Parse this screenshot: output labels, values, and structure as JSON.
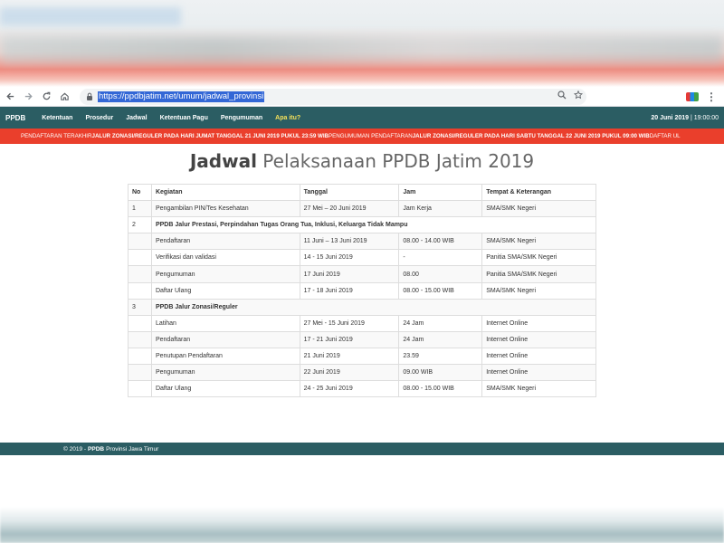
{
  "browser": {
    "url": "https://ppdbjatim.net/umum/jadwal_provinsi",
    "back_icon": "arrow-left-icon",
    "forward_icon": "arrow-right-icon",
    "reload_icon": "reload-icon",
    "home_icon": "home-icon"
  },
  "navbar": {
    "brand": "PPDB",
    "items": [
      {
        "label": "Ketentuan"
      },
      {
        "label": "Prosedur"
      },
      {
        "label": "Jadwal"
      },
      {
        "label": "Ketentuan Pagu"
      },
      {
        "label": "Pengumuman"
      },
      {
        "label": "Apa itu?"
      }
    ],
    "date": "20 Juni 2019",
    "separator": "|",
    "time": "19:00:00",
    "bg_color": "#2b5d63",
    "highlight_color": "#f5e15a"
  },
  "ticker": {
    "p1": "PENDAFTARAN TERAKHIR ",
    "b1": "JALUR ZONASI/REGULER PADA HARI JUMAT TANGGAL 21 JUNI 2019 PUKUL 23:59 WIB",
    "p2": " PENGUMUMAN PENDAFTARAN ",
    "b2": "JALUR ZONASI/REGULER PADA HARI SABTU TANGGAL 22 JUNI 2019 PUKUL 09:00 WIB",
    "p3": " DAFTAR UL",
    "bg_color": "#ea3f2c"
  },
  "title": {
    "strong": "Jadwal",
    "light": " Pelaksanaan PPDB Jatim 2019"
  },
  "table": {
    "headers": [
      "No",
      "Kegiatan",
      "Tanggal",
      "Jam",
      "Tempat & Keterangan"
    ],
    "rows": [
      {
        "no": "1",
        "kegiatan": "Pengambilan PIN/Tes Kesehatan",
        "tanggal": "27 Mei – 20 Juni 2019",
        "jam": "Jam Kerja",
        "tempat": "SMA/SMK Negeri"
      },
      {
        "no": "2",
        "section": "PPDB Jalur Prestasi, Perpindahan Tugas Orang Tua, Inklusi, Keluarga Tidak Mampu"
      },
      {
        "no": "",
        "kegiatan": "Pendaftaran",
        "tanggal": "11 Juni – 13 Juni 2019",
        "jam": "08.00 - 14.00 WIB",
        "tempat": "SMA/SMK Negeri"
      },
      {
        "no": "",
        "kegiatan": "Verifikasi dan validasi",
        "tanggal": "14 - 15 Juni 2019",
        "jam": "-",
        "tempat": "Panitia SMA/SMK Negeri"
      },
      {
        "no": "",
        "kegiatan": "Pengumuman",
        "tanggal": "17 Juni 2019",
        "jam": "08.00",
        "tempat": "Panitia SMA/SMK Negeri"
      },
      {
        "no": "",
        "kegiatan": "Daftar Ulang",
        "tanggal": "17 - 18 Juni 2019",
        "jam": "08.00 - 15.00 WIB",
        "tempat": "SMA/SMK Negeri"
      },
      {
        "no": "3",
        "section": "PPDB Jalur Zonasi/Reguler"
      },
      {
        "no": "",
        "kegiatan": "Latihan",
        "tanggal": "27 Mei - 15 Juni 2019",
        "jam": "24 Jam",
        "tempat": "Internet Online"
      },
      {
        "no": "",
        "kegiatan": "Pendaftaran",
        "tanggal": "17 - 21 Juni 2019",
        "jam": "24 Jam",
        "tempat": "Internet Online"
      },
      {
        "no": "",
        "kegiatan": "Penutupan Pendaftaran",
        "tanggal": "21 Juni 2019",
        "jam": "23.59",
        "tempat": "Internet Online"
      },
      {
        "no": "",
        "kegiatan": "Pengumuman",
        "tanggal": "22 Juni 2019",
        "jam": "09.00 WIB",
        "tempat": "Internet Online"
      },
      {
        "no": "",
        "kegiatan": "Daftar Ulang",
        "tanggal": "24 - 25 Juni 2019",
        "jam": "08.00 - 15.00 WIB",
        "tempat": "SMA/SMK Negeri"
      }
    ]
  },
  "footer": {
    "prefix": "© 2019 -",
    "brand": "PPDB",
    "suffix": "Provinsi Jawa Timur"
  }
}
